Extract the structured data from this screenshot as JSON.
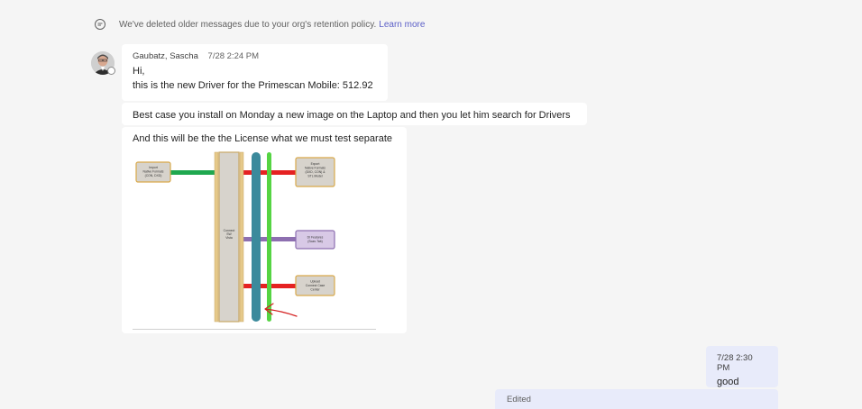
{
  "notice": {
    "text": "We've deleted older messages due to your org's retention policy.",
    "link": "Learn more"
  },
  "message1": {
    "sender": "Gaubatz, Sascha",
    "time": "7/28 2:24 PM",
    "line1": "Hi,",
    "line2": "this is the new Driver for the Primescan Mobile: 512.92"
  },
  "message2": {
    "text": "Best case you install on Monday a new image on the Laptop and then you let him search for Drivers"
  },
  "message3": {
    "text": "And this will be the the License what we must test separate",
    "diagram": {
      "boxes": [
        {
          "label": "Import Native Formats (CON, DXD)"
        },
        {
          "label": "Connect SW Vista"
        },
        {
          "label": "Export Native Formats (DXD, CON) & STL Model"
        },
        {
          "label": "DI Features (Scan-Tab)"
        },
        {
          "label": "Upload Connect Case Center"
        }
      ],
      "colors": {
        "green": "#1fa84f",
        "red": "#e52222",
        "purple": "#8d6fb0",
        "teal": "#3b8a9c",
        "lime": "#55d443",
        "tan": "#e5c98a"
      }
    }
  },
  "reply": {
    "time": "7/28 2:30 PM",
    "text": "good"
  },
  "edited": {
    "text": "Edited"
  }
}
